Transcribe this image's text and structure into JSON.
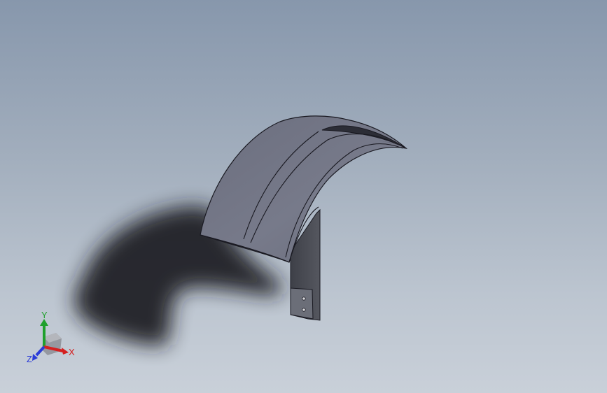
{
  "viewport": {
    "background_top": "#8797ac",
    "background_bottom": "#c9d0d9"
  },
  "model": {
    "part_color": "#6f7282",
    "edge_color": "#1a1a22",
    "shadow_color": "#1c1c20"
  },
  "triad": {
    "x_label": "X",
    "y_label": "Y",
    "z_label": "Z",
    "x_color": "#d42020",
    "y_color": "#1fa02c",
    "z_color": "#2a3bd8"
  }
}
